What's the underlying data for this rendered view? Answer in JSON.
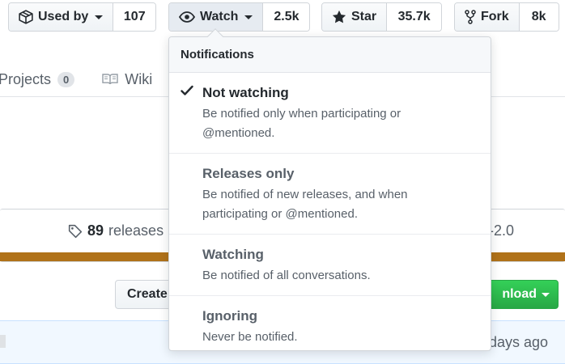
{
  "buttons": {
    "used_by": {
      "label": "Used by",
      "count": "107"
    },
    "watch": {
      "label": "Watch",
      "count": "2.5k"
    },
    "star": {
      "label": "Star",
      "count": "35.7k"
    },
    "fork": {
      "label": "Fork",
      "count": "8k"
    }
  },
  "tabs": [
    {
      "label": "Projects",
      "counter": "0"
    },
    {
      "label": "Wiki"
    }
  ],
  "summary": {
    "releases_count": "89",
    "releases_label": "releases",
    "license_partial": "-2.0"
  },
  "actions": {
    "create_label": "Create",
    "download_label": "nload"
  },
  "commit": {
    "time_partial": "days ago"
  },
  "dropdown": {
    "header": "Notifications",
    "options": [
      {
        "title": "Not watching",
        "desc1": "Be notified only when participating or",
        "desc2": "@mentioned.",
        "selected": true
      },
      {
        "title": "Releases only",
        "desc1": "Be notified of new releases, and when",
        "desc2": "participating or @mentioned.",
        "selected": false
      },
      {
        "title": "Watching",
        "desc1": "Be notified of all conversations.",
        "selected": false
      },
      {
        "title": "Ignoring",
        "desc1": "Never be notified.",
        "selected": false
      }
    ]
  },
  "colors": {
    "accent_green": "#28a745",
    "language_bar": "#b07219",
    "commit_bg": "#f1f8ff"
  }
}
